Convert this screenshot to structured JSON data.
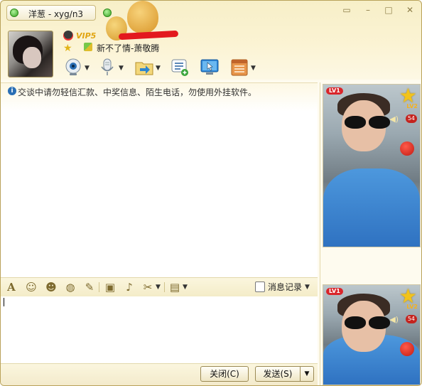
{
  "window": {
    "title": "洋葱 - xyg/n3",
    "controls": [
      "restore",
      "minimize",
      "maximize",
      "close"
    ]
  },
  "profile": {
    "vip_label": "VIP5",
    "signature": "新不了情-萧敬腾"
  },
  "toolbar": {
    "items": [
      "video-call",
      "voice-call",
      "send-file",
      "create-discussion",
      "remote-assist",
      "apps"
    ]
  },
  "chat": {
    "notice": "交谈中请勿轻信汇款、中奖信息、陌生电话，勿使用外挂软件。"
  },
  "format_toolbar": {
    "history_label": "消息记录"
  },
  "footer": {
    "close_label": "关闭(C)",
    "send_label": "发送(S)"
  },
  "side": {
    "top": {
      "level_tag": "LV1",
      "level_small": "LV2",
      "volume": "54"
    },
    "bottom": {
      "level_tag": "LV1",
      "level_small": "LV2",
      "volume": "54"
    }
  },
  "colors": {
    "frame": "#b9a25a",
    "header_bg": "#f7efc8",
    "accent_red": "#d9252a",
    "star": "#f2c31b"
  }
}
